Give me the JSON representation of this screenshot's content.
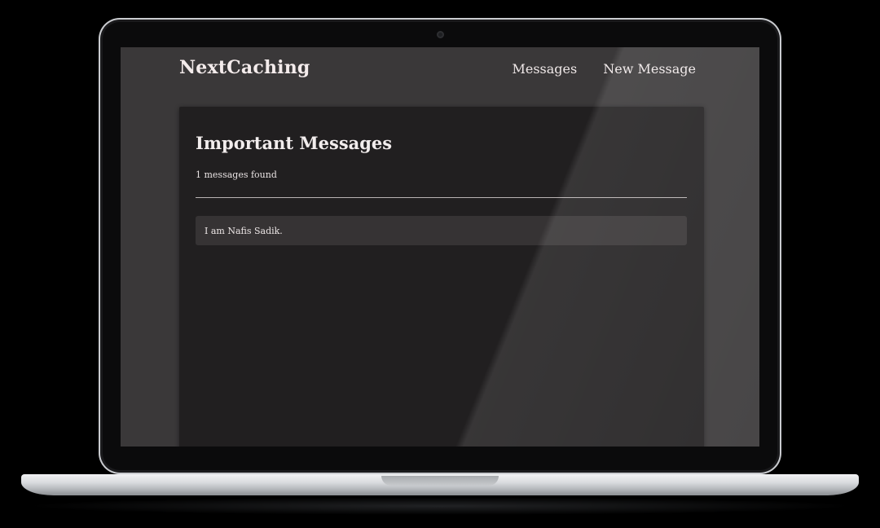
{
  "app": {
    "brand": "NextCaching"
  },
  "nav": {
    "items": [
      {
        "label": "Messages"
      },
      {
        "label": "New Message"
      }
    ]
  },
  "main": {
    "title": "Important Messages",
    "count_text": "1 messages found",
    "messages": [
      {
        "text": "I am Nafis Sadik."
      }
    ]
  }
}
